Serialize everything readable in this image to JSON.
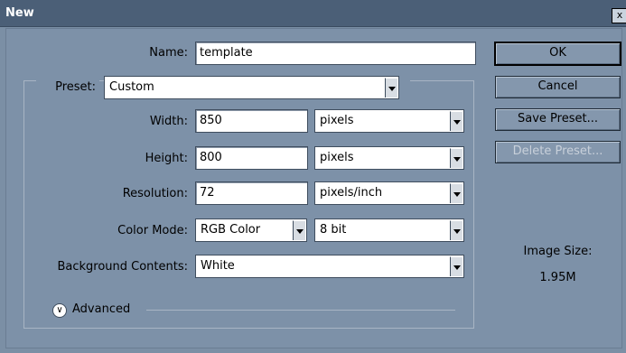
{
  "window": {
    "title": "New",
    "close_label": "x"
  },
  "form": {
    "name_label": "Name:",
    "name_value": "template",
    "preset_label": "Preset:",
    "preset_value": "Custom",
    "width_label": "Width:",
    "width_value": "850",
    "width_unit": "pixels",
    "height_label": "Height:",
    "height_value": "800",
    "height_unit": "pixels",
    "resolution_label": "Resolution:",
    "resolution_value": "72",
    "resolution_unit": "pixels/inch",
    "color_mode_label": "Color Mode:",
    "color_mode_value": "RGB Color",
    "bit_depth_value": "8 bit",
    "background_label": "Background Contents:",
    "background_value": "White",
    "advanced_label": "Advanced"
  },
  "buttons": {
    "ok": "OK",
    "cancel": "Cancel",
    "save_preset": "Save Preset...",
    "delete_preset": "Delete Preset..."
  },
  "image_size": {
    "label": "Image Size:",
    "value": "1.95M"
  },
  "icons": {
    "advanced_toggle": "chevron-down-circle-icon",
    "dropdown": "chevron-down-icon"
  },
  "colors": {
    "dialog_bg": "#7b8fa5",
    "titlebar": "#4b5f77"
  }
}
